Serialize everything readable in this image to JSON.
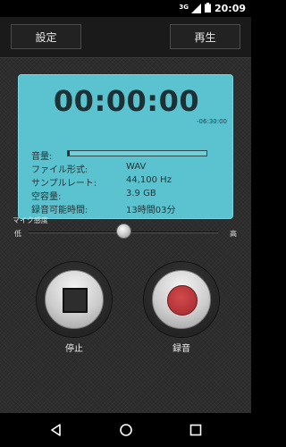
{
  "status_bar": {
    "network": "3G",
    "time": "20:09"
  },
  "header": {
    "settings_label": "設定",
    "play_label": "再生"
  },
  "display": {
    "elapsed_time": "00:00:00",
    "remaining_time": "-06:30:00",
    "level_label": "音量:",
    "level_value": 0.015,
    "format_label": "ファイル形式:",
    "format_value": "WAV",
    "sample_rate_label": "サンプルレート:",
    "sample_rate_value": "44,100 Hz",
    "free_space_label": "空容量:",
    "free_space_value": "3.9 GB",
    "recordable_label": "録音可能時間:",
    "recordable_value": "13時間03分"
  },
  "mic": {
    "label": "マイク感度",
    "low_label": "低",
    "high_label": "高",
    "sensitivity": 0.5
  },
  "controls": {
    "stop_label": "停止",
    "record_label": "録音"
  },
  "colors": {
    "lcd": "#5bc3cf",
    "record": "#b03236"
  },
  "nav": {
    "back_icon": "back-triangle-icon",
    "home_icon": "home-circle-icon",
    "recents_icon": "recents-square-icon"
  }
}
